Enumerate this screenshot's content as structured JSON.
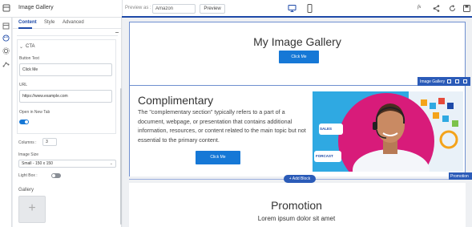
{
  "panel": {
    "title": "Image Gallery",
    "tabs": [
      "Content",
      "Style",
      "Advanced"
    ],
    "cta_section": "CTA",
    "button_text_label": "Button Text",
    "button_text_value": "Click Me",
    "url_label": "URL",
    "url_value": "https://www.example.com",
    "open_new_tab_label": "Open in New Tab",
    "open_new_tab_on": true,
    "columns_label": "Columns :",
    "columns_value": "3",
    "image_size_label": "Image Size",
    "image_size_value": "Small - 150 x 150",
    "lightbox_label": "Light Box :",
    "lightbox_on": false,
    "gallery_label": "Gallery",
    "gallery_add_symbol": "+"
  },
  "topbar": {
    "preview_label": "Preview as :",
    "preview_value": "Amazon",
    "preview_button": "Preview",
    "fx_label": "fx"
  },
  "canvas": {
    "gallery_title": "My Image Gallery",
    "gallery_button": "Click Me",
    "gallery_tag": "Image Gallery",
    "comp_heading": "Complimentary",
    "comp_body": "The \"complementary section\" typically refers to a part of a document, webpage, or presentation that contains additional information, resources, or content related to the main topic but not essential to the primary content.",
    "comp_button": "Click Me",
    "hero_labels": [
      "SALES",
      "FORCAST"
    ],
    "promo_tag": "Promotion",
    "add_block": "+ Add Block",
    "promo_heading": "Promotion",
    "promo_sub": "Lorem ipsum dolor sit amet"
  },
  "colors": {
    "accent": "#1e4aa8",
    "button": "#1678d6",
    "toggle_on": "#1678d6",
    "toggle_off": "#8a8f96",
    "hero_pink": "#d81b7a"
  },
  "icons": [
    "layers-icon",
    "palette-icon",
    "settings-icon",
    "analytics-icon",
    "desktop-icon",
    "mobile-icon",
    "share-icon",
    "refresh-icon",
    "save-icon"
  ]
}
